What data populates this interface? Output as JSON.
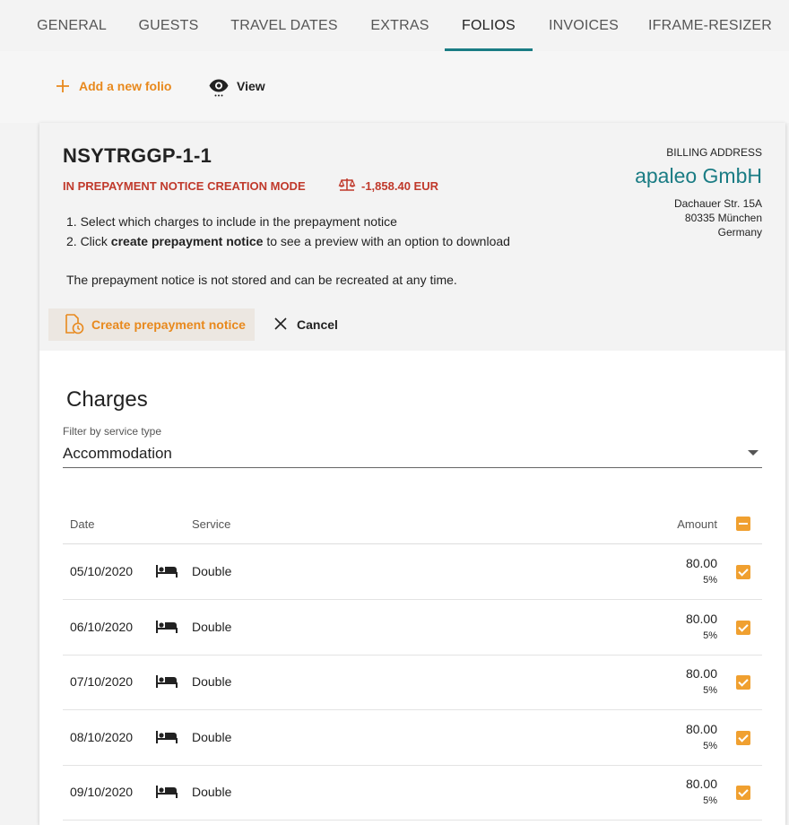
{
  "tabs": [
    {
      "label": "GENERAL"
    },
    {
      "label": "GUESTS"
    },
    {
      "label": "TRAVEL DATES"
    },
    {
      "label": "EXTRAS"
    },
    {
      "label": "FOLIOS",
      "active": true
    },
    {
      "label": "INVOICES"
    },
    {
      "label": "IFRAME-RESIZER"
    }
  ],
  "toolbar": {
    "add_label": "Add a new folio",
    "view_label": "View"
  },
  "folio": {
    "id": "NSYTRGGP-1-1",
    "mode": "IN PREPAYMENT NOTICE CREATION MODE",
    "balance": "-1,858.40 EUR",
    "step1": "1. Select which charges to include in the prepayment notice",
    "step2_prefix": "2. Click",
    "step2_bold": "create prepayment notice",
    "step2_suffix": "to see a preview with an option to download",
    "note": "The prepayment notice is not stored and can be recreated at any time.",
    "create_label": "Create prepayment notice",
    "cancel_label": "Cancel"
  },
  "billing": {
    "label": "BILLING ADDRESS",
    "company": "apaleo GmbH",
    "street": "Dachauer Str. 15A",
    "city": "80335 München",
    "country": "Germany"
  },
  "charges": {
    "title": "Charges",
    "filter_label": "Filter by service type",
    "filter_value": "Accommodation",
    "columns": {
      "date": "Date",
      "service": "Service",
      "amount": "Amount"
    },
    "rows": [
      {
        "date": "05/10/2020",
        "service": "Double",
        "amount": "80.00",
        "vat": "5%"
      },
      {
        "date": "06/10/2020",
        "service": "Double",
        "amount": "80.00",
        "vat": "5%"
      },
      {
        "date": "07/10/2020",
        "service": "Double",
        "amount": "80.00",
        "vat": "5%"
      },
      {
        "date": "08/10/2020",
        "service": "Double",
        "amount": "80.00",
        "vat": "5%"
      },
      {
        "date": "09/10/2020",
        "service": "Double",
        "amount": "80.00",
        "vat": "5%"
      }
    ]
  },
  "colors": {
    "accent": "#e8891d",
    "teal": "#1a7c84",
    "alert": "#c0392b",
    "checkbox": "#f0a030"
  }
}
